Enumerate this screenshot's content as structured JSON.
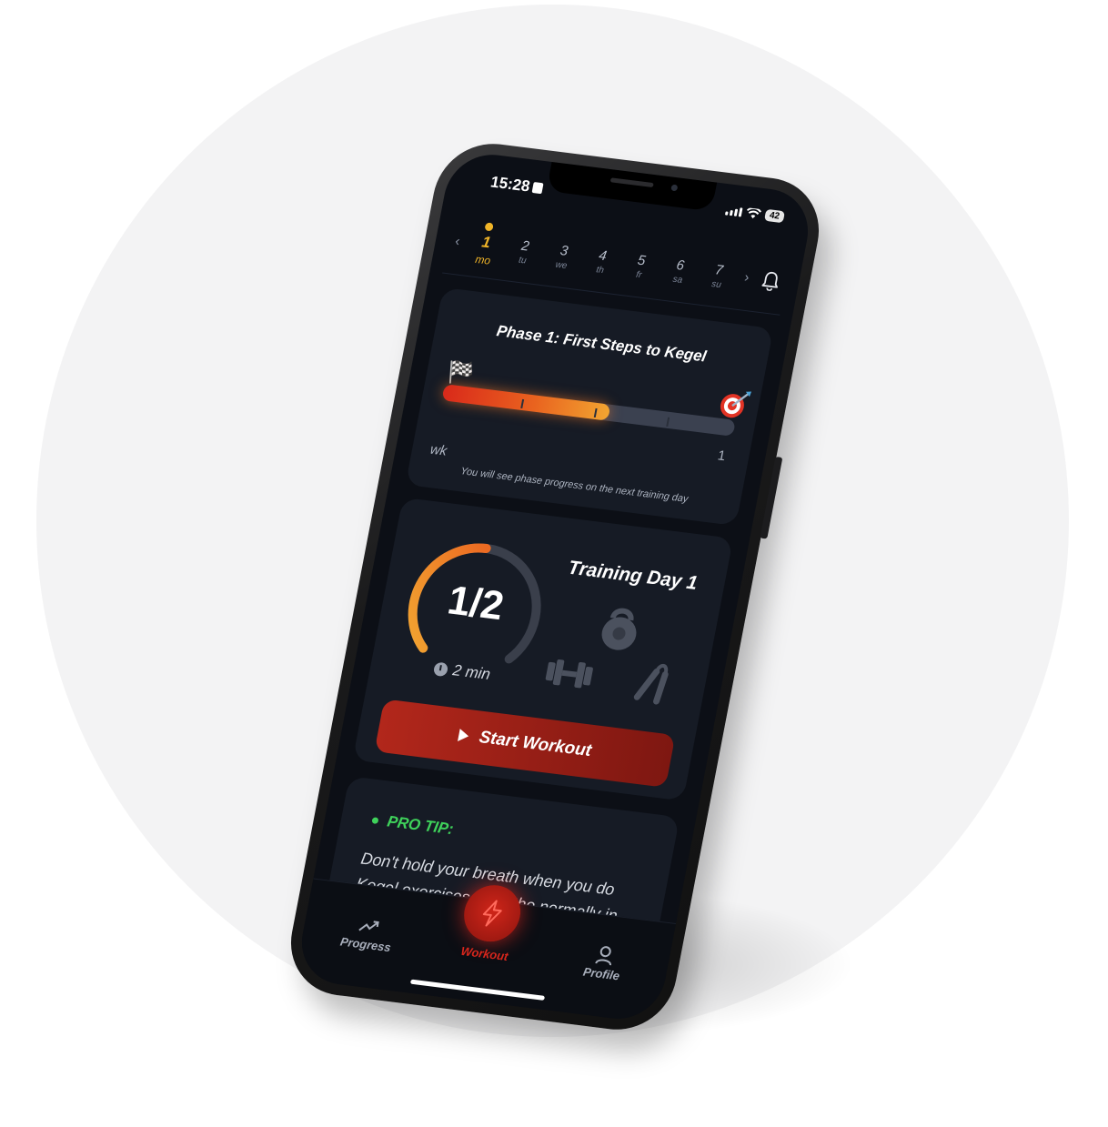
{
  "status_bar": {
    "time": "15:28",
    "battery": "42"
  },
  "week": {
    "prev_icon": "chevron-left-icon",
    "next_icon": "chevron-right-icon",
    "days": [
      {
        "num": "1",
        "label": "mo",
        "active": true
      },
      {
        "num": "2",
        "label": "tu"
      },
      {
        "num": "3",
        "label": "we"
      },
      {
        "num": "4",
        "label": "th"
      },
      {
        "num": "5",
        "label": "fr"
      },
      {
        "num": "6",
        "label": "sa"
      },
      {
        "num": "7",
        "label": "su"
      }
    ],
    "notification_icon": "bell-icon"
  },
  "phase": {
    "title": "Phase 1: First Steps to Kegel",
    "progress_fraction": 0.57,
    "unit_label": "wk",
    "end_week": "1",
    "note": "You will see phase progress on the next training day"
  },
  "training": {
    "title": "Training Day 1",
    "progress_label": "1/2",
    "progress_fraction": 0.5,
    "duration": "2 min",
    "start_label": "Start Workout",
    "equipment_icons": [
      "kettlebell-icon",
      "dumbbell-icon",
      "hand-grip-icon"
    ]
  },
  "tip": {
    "heading": "PRO TIP:",
    "text": "Don't hold your breath when you do Kegel exercises. Breathe normally in"
  },
  "tabs": {
    "progress": "Progress",
    "workout": "Workout",
    "profile": "Profile"
  },
  "colors": {
    "accent_orange": "#f0b428",
    "accent_red": "#d8261c",
    "tip_green": "#3fd25b",
    "screen_bg": "#0c0f16",
    "card_bg": "#161b25"
  }
}
